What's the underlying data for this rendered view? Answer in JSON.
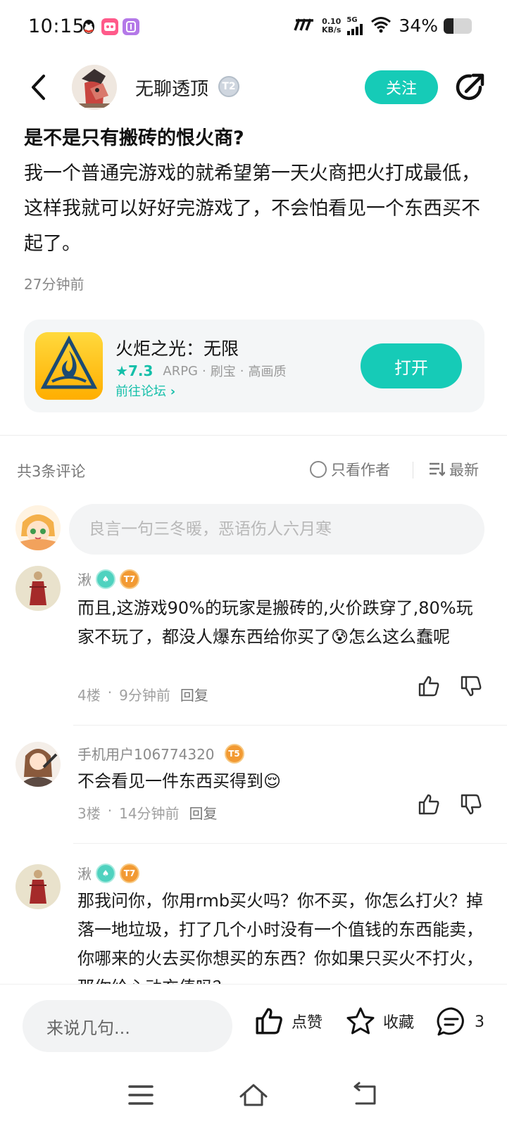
{
  "status_bar": {
    "time": "10:15",
    "speed_value": "0.10",
    "speed_unit": "KB/s",
    "network": "5G",
    "battery_percent": "34%",
    "battery_level": 0.34
  },
  "header": {
    "author_name": "无聊透顶",
    "author_level": "T2",
    "follow_label": "关注"
  },
  "post": {
    "title": "是不是只有搬砖的恨火商?",
    "body": "我一个普通完游戏的就希望第一天火商把火打成最低，这样我就可以好好完游戏了，不会怕看见一个东西买不起了。",
    "time": "27分钟前"
  },
  "game_card": {
    "title": "火炬之光：无限",
    "rating": "7.3",
    "tags": [
      "ARPG",
      "刷宝",
      "高画质"
    ],
    "forum_link": "前往论坛",
    "open_label": "打开"
  },
  "comments_header": {
    "count_label": "共3条评论",
    "author_only_label": "只看作者",
    "sort_label": "最新"
  },
  "comment_input": {
    "placeholder": "良言一句三冬暖，恶语伤人六月寒"
  },
  "comments": [
    {
      "user": "湫",
      "level": "T7",
      "text": "而且,这游戏90%的玩家是搬砖的,火价跌穿了,80%玩家不玩了，都没人爆东西给你买了😰怎么这么蠢呢",
      "floor": "4楼",
      "time": "9分钟前",
      "reply_label": "回复"
    },
    {
      "user": "手机用户106774320",
      "level": "T5",
      "text": "不会看见一件东西买得到😌",
      "floor": "3楼",
      "time": "14分钟前",
      "reply_label": "回复"
    },
    {
      "user": "湫",
      "level": "T7",
      "text": "那我问你，你用rmb买火吗？你不买，你怎么打火？掉落一地垃圾，打了几个小时没有一个值钱的东西能卖，你哪来的火去买你想买的东西？你如果只买火不打火，那你给心动充值吗？"
    }
  ],
  "bottom_bar": {
    "input_label": "来说几句...",
    "like_label": "点赞",
    "favorite_label": "收藏",
    "comment_count": "3"
  },
  "colors": {
    "accent": "#16cbb7",
    "level_orange": "#f29a33",
    "text_secondary": "#888888"
  }
}
